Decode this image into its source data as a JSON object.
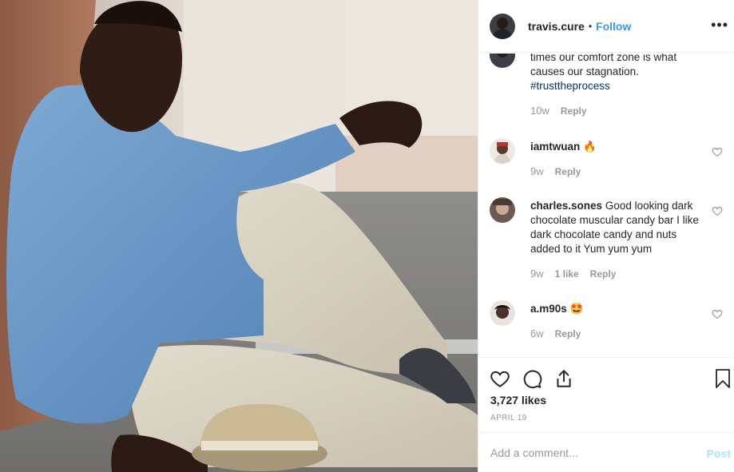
{
  "header": {
    "username": "travis.cure",
    "separator": "•",
    "follow_label": "Follow",
    "more_label": "•••"
  },
  "comments": {
    "caption_tail": {
      "line1": "times our comfort zone is what",
      "line2": "causes our stagnation.",
      "hashtag": "#trusttheprocess",
      "time": "10w",
      "reply_label": "Reply"
    },
    "items": [
      {
        "username": "iamtwuan",
        "text": "🔥",
        "time": "9w",
        "likes": "",
        "reply_label": "Reply"
      },
      {
        "username": "charles.sones",
        "text": "Good looking dark chocolate muscular candy bar I like dark chocolate candy and nuts added to it Yum yum yum",
        "time": "9w",
        "likes": "1 like",
        "reply_label": "Reply"
      },
      {
        "username": "a.m90s",
        "text": "🤩",
        "time": "6w",
        "likes": "",
        "reply_label": "Reply"
      }
    ]
  },
  "actions": {
    "like_icon": "heart-icon",
    "comment_icon": "comment-icon",
    "share_icon": "share-icon",
    "save_icon": "bookmark-icon",
    "likes_count": "3,727 likes",
    "date": "APRIL 19"
  },
  "add_comment": {
    "placeholder": "Add a comment...",
    "post_label": "Post"
  },
  "colors": {
    "link_blue": "#3897f0",
    "hashtag_blue": "#003569",
    "muted": "#999999",
    "post_disabled": "#b2dffc"
  }
}
